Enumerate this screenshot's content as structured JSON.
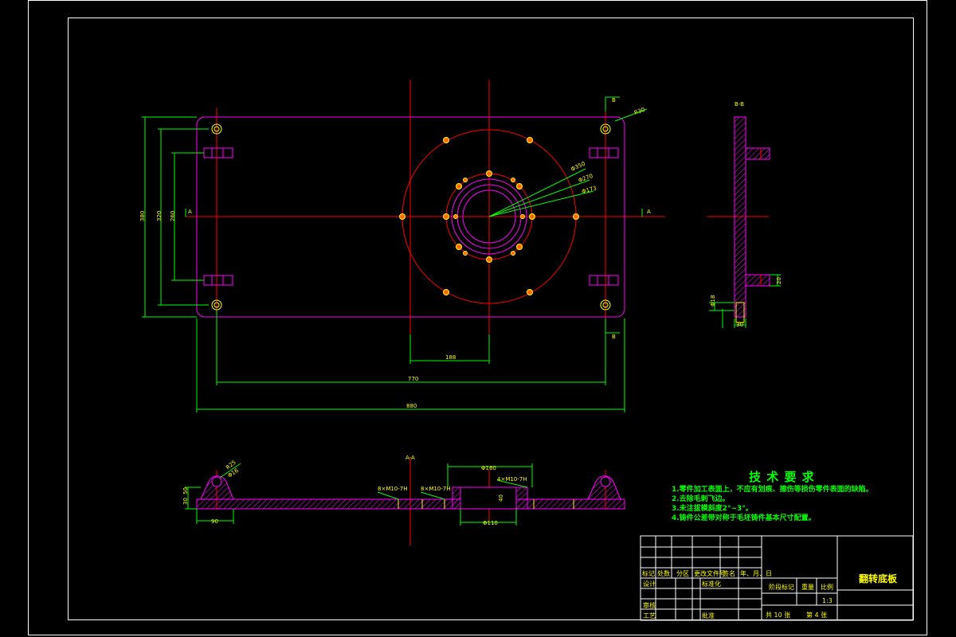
{
  "section_labels": {
    "view_bb": "B-B",
    "view_aa": "A-A",
    "cut_b_top": "B",
    "cut_b_bottom": "B",
    "cut_a_left": "A",
    "cut_a_right": "A"
  },
  "dimensions": {
    "width_overall": "880",
    "width_holes": "770",
    "offset_center": "188",
    "height_overall": "380",
    "height_inner": "320",
    "height_slots": "260",
    "corner_radius": "R30",
    "pcd_outer": "Φ350",
    "pcd_mid": "Φ270",
    "pcd_inner": "Φ173",
    "bottom_width": "90",
    "bottom_thk": "30",
    "bottom_h": "50",
    "boss_r": "R25",
    "boss_d": "Φ16",
    "bore_top": "Φ160",
    "bore_bottom": "Φ110",
    "thread_left1": "8×M10-7H",
    "thread_left2": "8×M10-7H",
    "thread_right": "4×M10-7H",
    "bore_depth": "40",
    "side_d": "Φ18",
    "side_h": "20",
    "side_w": "30"
  },
  "tech": {
    "title": "技 术 要 求",
    "notes": [
      "1.零件加工表面上，不应有划痕、擦伤等损伤零件表面的缺陷。",
      "2.去除毛刺飞边。",
      "3.未注拔模斜度2°~3°。",
      "4.铸件公差带对称于毛坯铸件基本尺寸配置。"
    ]
  },
  "title_block": {
    "drawing_name": "翻转底板",
    "scale": "1:3",
    "col_labels": [
      "标记",
      "处数",
      "分区",
      "更改文件号",
      "签名",
      "年、月、日"
    ],
    "designer": "设计",
    "standardize": "标准化",
    "review": "审核",
    "process": "工艺",
    "approve": "批准",
    "stage_mark": "阶段标记",
    "weight": "重量",
    "scale_label": "比例",
    "sheets_total": "共 10 张",
    "sheet_no": "第 4 张"
  },
  "colors": {
    "outline": "#ff00ff",
    "centerline": "#ff0000",
    "dimension": "#00ff00",
    "hole": "#ffff00",
    "text": "#ffff00",
    "frame": "#ffffff"
  }
}
